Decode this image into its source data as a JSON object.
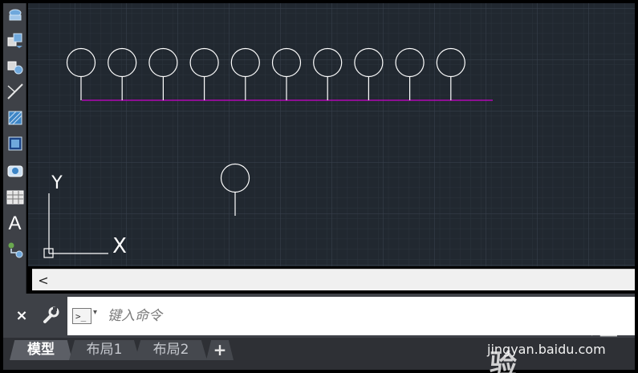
{
  "toolbar": {
    "tools": [
      {
        "name": "revolve-surface-icon"
      },
      {
        "name": "insert-block-icon"
      },
      {
        "name": "create-block-icon"
      },
      {
        "name": "line-tool-icon"
      },
      {
        "name": "hatch-icon"
      },
      {
        "name": "gradient-icon"
      },
      {
        "name": "region-icon"
      },
      {
        "name": "table-icon"
      },
      {
        "name": "multiline-text-icon"
      },
      {
        "name": "add-selected-icon"
      }
    ],
    "text_tool_glyph": "A"
  },
  "canvas": {
    "background": "#212830",
    "axis_labels": {
      "y": "Y",
      "x": "X"
    },
    "line_color": "#ffffff",
    "baseline_color": "#cc00cc",
    "row_circle_count": 10
  },
  "scrollbar": {
    "left_arrow": "<"
  },
  "command_line": {
    "close_label": "×",
    "input_placeholder": "键入命令",
    "prompt_caret": "▾"
  },
  "tabs": [
    {
      "label": "模型",
      "active": true
    },
    {
      "label": "布局1",
      "active": false
    },
    {
      "label": "布局2",
      "active": false
    }
  ],
  "add_tab_label": "+",
  "watermark": {
    "logo_text": "Bai du 经验",
    "url": "jingyan.baidu.com"
  }
}
